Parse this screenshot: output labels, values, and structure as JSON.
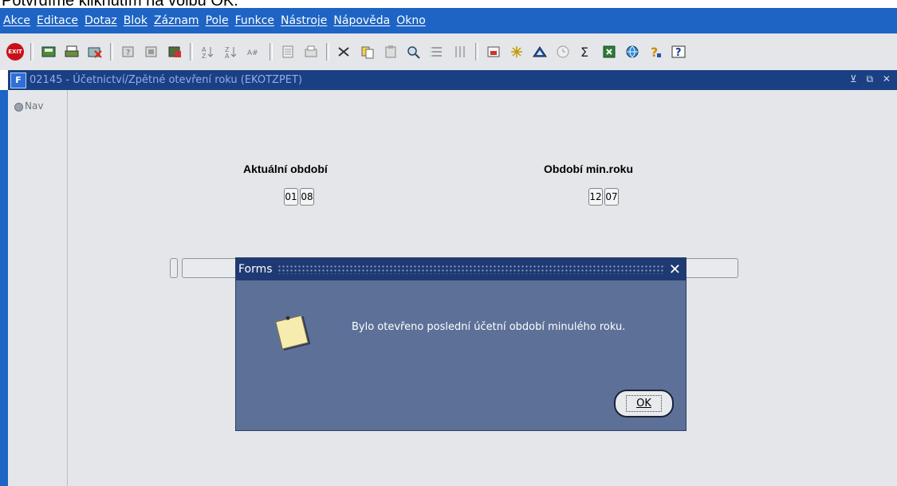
{
  "caption": "Potvrdíme kliknutím na volbu OK.",
  "menubar": {
    "items": [
      "Akce",
      "Editace",
      "Dotaz",
      "Blok",
      "Záznam",
      "Pole",
      "Funkce",
      "Nástroje",
      "Nápověda",
      "Okno"
    ]
  },
  "toolbar": {
    "exit_label": "EXIT",
    "icons": [
      "exit-icon",
      "save-icon",
      "print-icon",
      "clear-icon",
      "enter-query-icon",
      "execute-query-icon",
      "cancel-query-icon",
      "sort-asc-icon",
      "sort-desc-icon",
      "sort-multi-icon",
      "print-preview-icon",
      "print-setup-icon",
      "cut-icon",
      "copy-icon",
      "paste-icon",
      "search-icon",
      "list-icon",
      "columns-icon",
      "export-icon",
      "network-icon",
      "triangle-icon",
      "clock-icon",
      "sum-icon",
      "excel-icon",
      "globe-icon",
      "help-icon",
      "whats-this-icon"
    ]
  },
  "window": {
    "logo": "F",
    "title": "02145 - Účetnictví/Zpětné otevření roku (EKOTZPET)",
    "controls": "⊻ ⧉ ✕"
  },
  "nav": {
    "label": "Nav"
  },
  "form": {
    "current_period_label": "Aktuální období",
    "current_month": "01",
    "current_year": "08",
    "prev_period_label": "Období min.roku",
    "prev_month": "12",
    "prev_year": "07"
  },
  "dialog": {
    "title": "Forms",
    "close": "✕",
    "message": "Bylo otevřeno poslední účetní období minulého roku.",
    "ok_label": "OK"
  },
  "colors": {
    "menubar": "#1e64c4",
    "window_titlebar": "#1a3f83",
    "dialog_body": "#5d7198",
    "dialog_titlebar": "#1f3a73",
    "exit_red": "#c8101a"
  }
}
